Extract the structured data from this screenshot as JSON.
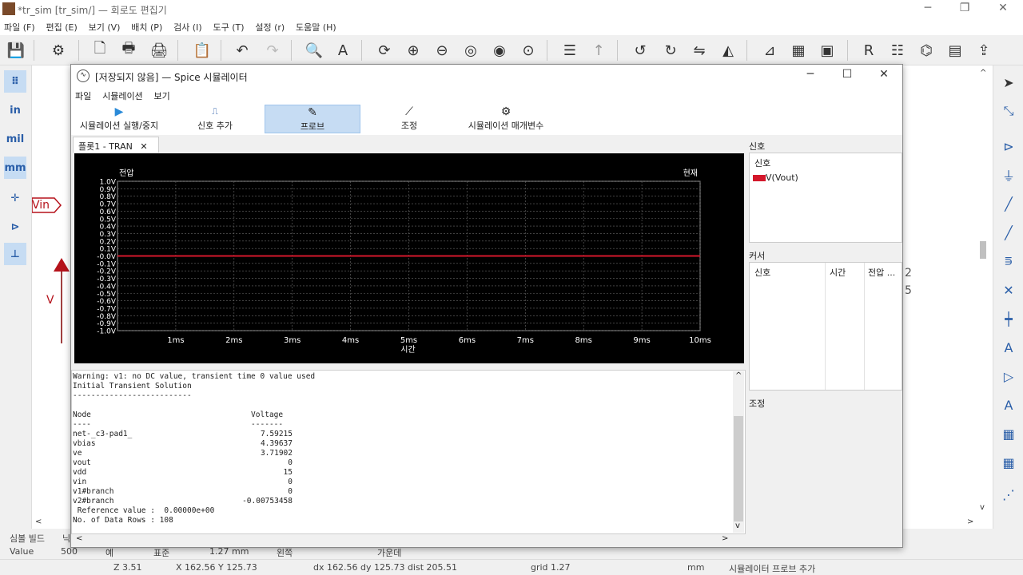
{
  "main_window": {
    "title": "*tr_sim [tr_sim/] — 회로도 편집기",
    "menu": [
      "파일 (F)",
      "편집 (E)",
      "보기 (V)",
      "배치 (P)",
      "검사 (I)",
      "도구 (T)",
      "설정 (r)",
      "도움말 (H)"
    ]
  },
  "canvas": {
    "vin_label": "Vin",
    "v_label": "V",
    "frag_1": "2",
    "frag_2": "5"
  },
  "status": {
    "row1": {
      "a": "심볼 빌드",
      "b": "닉",
      "value_label": "Value",
      "value": "500",
      "c": "예",
      "d": "표준",
      "e": "1.27 mm",
      "f": "왼쪽",
      "g": "가운데"
    },
    "zoom": "Z 3.51",
    "xy": "X 162.56  Y 125.73",
    "dxdy": "dx 162.56  dy 125.73  dist 205.51",
    "grid": "grid 1.27",
    "unit": "mm",
    "action": "시뮬레이터 프로브 추가"
  },
  "sim": {
    "title": "[저장되지 않음] — Spice 시뮬레이터",
    "menu": [
      "파일",
      "시뮬레이션",
      "보기"
    ],
    "tools": [
      {
        "label": "시뮬레이션 실행/중지",
        "icon": "run-icon"
      },
      {
        "label": "신호 추가",
        "icon": "add-signal-icon"
      },
      {
        "label": "프로브",
        "icon": "probe-icon"
      },
      {
        "label": "조정",
        "icon": "tune-icon"
      },
      {
        "label": "시뮬레이션 매개변수",
        "icon": "gear-icon"
      }
    ],
    "plot_tab": "플롯1 - TRAN",
    "plot_tab_close": "✕",
    "signals_title": "신호",
    "signals_header": "신호",
    "signal_item": "V(Vout)",
    "cursors_title": "커서",
    "cursor_cols": [
      "신호",
      "시간",
      "전압 ..."
    ],
    "tune_title": "조정",
    "log": {
      "lines": [
        "Warning: v1: no DC value, transient time 0 value used",
        "Initial Transient Solution",
        "--------------------------",
        "",
        "Node                                   Voltage",
        "----                                   -------"
      ],
      "nodes": [
        {
          "name": "net-_c3-pad1_",
          "value": "7.59215"
        },
        {
          "name": "vbias",
          "value": "4.39637"
        },
        {
          "name": "ve",
          "value": "3.71902"
        },
        {
          "name": "vout",
          "value": "0"
        },
        {
          "name": "vdd",
          "value": "15"
        },
        {
          "name": "vin",
          "value": "0"
        },
        {
          "name": "v1#branch",
          "value": "0"
        },
        {
          "name": "v2#branch",
          "value": "-0.00753458"
        }
      ],
      "ref": " Reference value :  0.00000e+00",
      "rows": "No. of Data Rows : 108"
    }
  },
  "chart_data": {
    "type": "line",
    "title": "",
    "ylabel": "전압",
    "y2label": "현재",
    "xlabel": "시간",
    "xlim": [
      0,
      10
    ],
    "ylim": [
      -1.0,
      1.0
    ],
    "x_ticks": [
      "1ms",
      "2ms",
      "3ms",
      "4ms",
      "5ms",
      "6ms",
      "7ms",
      "8ms",
      "9ms",
      "10ms"
    ],
    "y_ticks": [
      "1.0V",
      "0.9V",
      "0.8V",
      "0.7V",
      "0.6V",
      "0.5V",
      "0.4V",
      "0.3V",
      "0.2V",
      "0.1V",
      "-0.0V",
      "-0.1V",
      "-0.2V",
      "-0.3V",
      "-0.4V",
      "-0.5V",
      "-0.6V",
      "-0.7V",
      "-0.8V",
      "-0.9V",
      "-1.0V"
    ],
    "grid": true,
    "background": "#000000",
    "series": [
      {
        "name": "V(Vout)",
        "color": "#d3172b",
        "x": [
          0,
          10
        ],
        "y": [
          0,
          0
        ]
      }
    ]
  },
  "colors": {
    "accent": "#2a5ea8",
    "selected_tool": "#c6dcf3",
    "trace": "#d3172b",
    "schematic_red": "#b5121b",
    "wire": "#800000"
  }
}
